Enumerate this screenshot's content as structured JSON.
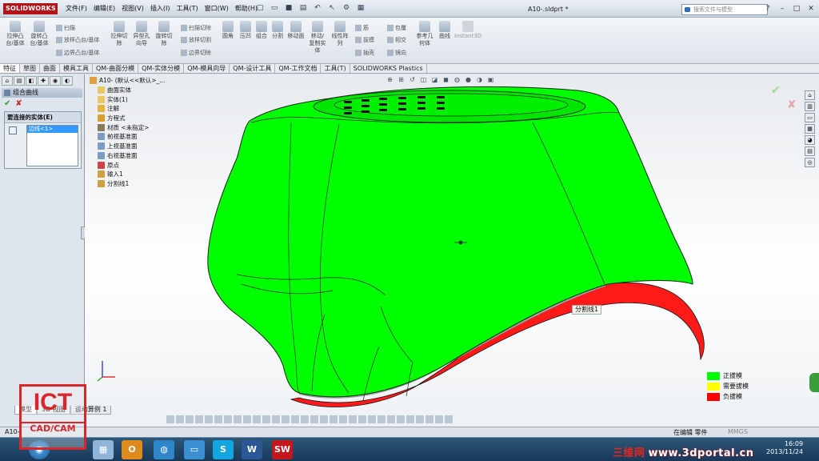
{
  "app": {
    "logo": "SOLIDWORKS",
    "doc_title": "A10-.sldprt *"
  },
  "menu": [
    "文件(F)",
    "编辑(E)",
    "视图(V)",
    "插入(I)",
    "工具(T)",
    "窗口(W)",
    "帮助(H)"
  ],
  "search": {
    "placeholder": "搜索文件与模型"
  },
  "commands": {
    "extrude_boss": "拉伸凸台/基体",
    "revolve_boss": "旋转凸台/基体",
    "sweep": "扫描",
    "loft": "放样凸台/基体",
    "boundary_boss": "边界凸台/基体",
    "extrude_cut": "拉伸切除",
    "hole_wizard": "异型孔向导",
    "revolve_cut": "旋转切除",
    "sweep_cut": "扫描切除",
    "loft_cut": "放样切割",
    "boundary_cut": "边界切除",
    "fillet": "圆角",
    "draft": "压凹",
    "combine": "组合",
    "split": "分割",
    "move_face": "移动面",
    "move_copy": "移动/复制实体",
    "linear_pattern": "线性阵列",
    "rib": "筋",
    "shell_pull": "拔模",
    "shell": "抽壳",
    "wrap": "包覆",
    "intersect": "相交",
    "mirror": "镜向",
    "ref_geometry": "参考几何体",
    "curves": "曲线",
    "instant3d": "Instant3D"
  },
  "tabs": [
    "特征",
    "草图",
    "曲面",
    "模具工具",
    "QM-曲面分模",
    "QM-实体分模",
    "QM-模具向导",
    "QM-设计工具",
    "QM-工作文档",
    "工具(T)",
    "SOLIDWORKS Plastics"
  ],
  "property_manager": {
    "title": "组合曲线",
    "group_title": "要连接的实体(E)",
    "selected_item": "边线<1>"
  },
  "tree": [
    {
      "label": "A10- (默认<<默认>_...",
      "icon": "part-icon"
    },
    {
      "label": "曲面实体",
      "icon": "folder-icon"
    },
    {
      "label": "实体(1)",
      "icon": "folder-icon"
    },
    {
      "label": "注解",
      "icon": "annotation-icon"
    },
    {
      "label": "方程式",
      "icon": "equation-icon"
    },
    {
      "label": "材质 <未指定>",
      "icon": "material-icon"
    },
    {
      "label": "前视基准面",
      "icon": "plane-icon"
    },
    {
      "label": "上视基准面",
      "icon": "plane-icon"
    },
    {
      "label": "右视基准面",
      "icon": "plane-icon"
    },
    {
      "label": "原点",
      "icon": "origin-icon"
    },
    {
      "label": "输入1",
      "icon": "import-icon"
    },
    {
      "label": "分割线1",
      "icon": "splitline-icon"
    }
  ],
  "callout": "分割线1",
  "legend": [
    {
      "label": "正拔模",
      "color": "#00ff00"
    },
    {
      "label": "需要拔模",
      "color": "#ffff00"
    },
    {
      "label": "负拔模",
      "color": "#ff0000"
    }
  ],
  "bottom_tabs": [
    "模型",
    "3D 视图",
    "运动算例 1"
  ],
  "status": {
    "left": "A10-",
    "editing": "在编辑 零件",
    "units": "MMGS"
  },
  "taskbar": {
    "time": "16:09",
    "date": "2013/11/24"
  },
  "watermark": {
    "cn": "三维网",
    "url": "www.3dportal.cn"
  },
  "overlay_logo": {
    "big": "ICT",
    "small": "CAD/CAM"
  },
  "colors": {
    "positive_draft": "#00ff00",
    "negative_draft": "#ff0000",
    "accent": "#b31217"
  }
}
